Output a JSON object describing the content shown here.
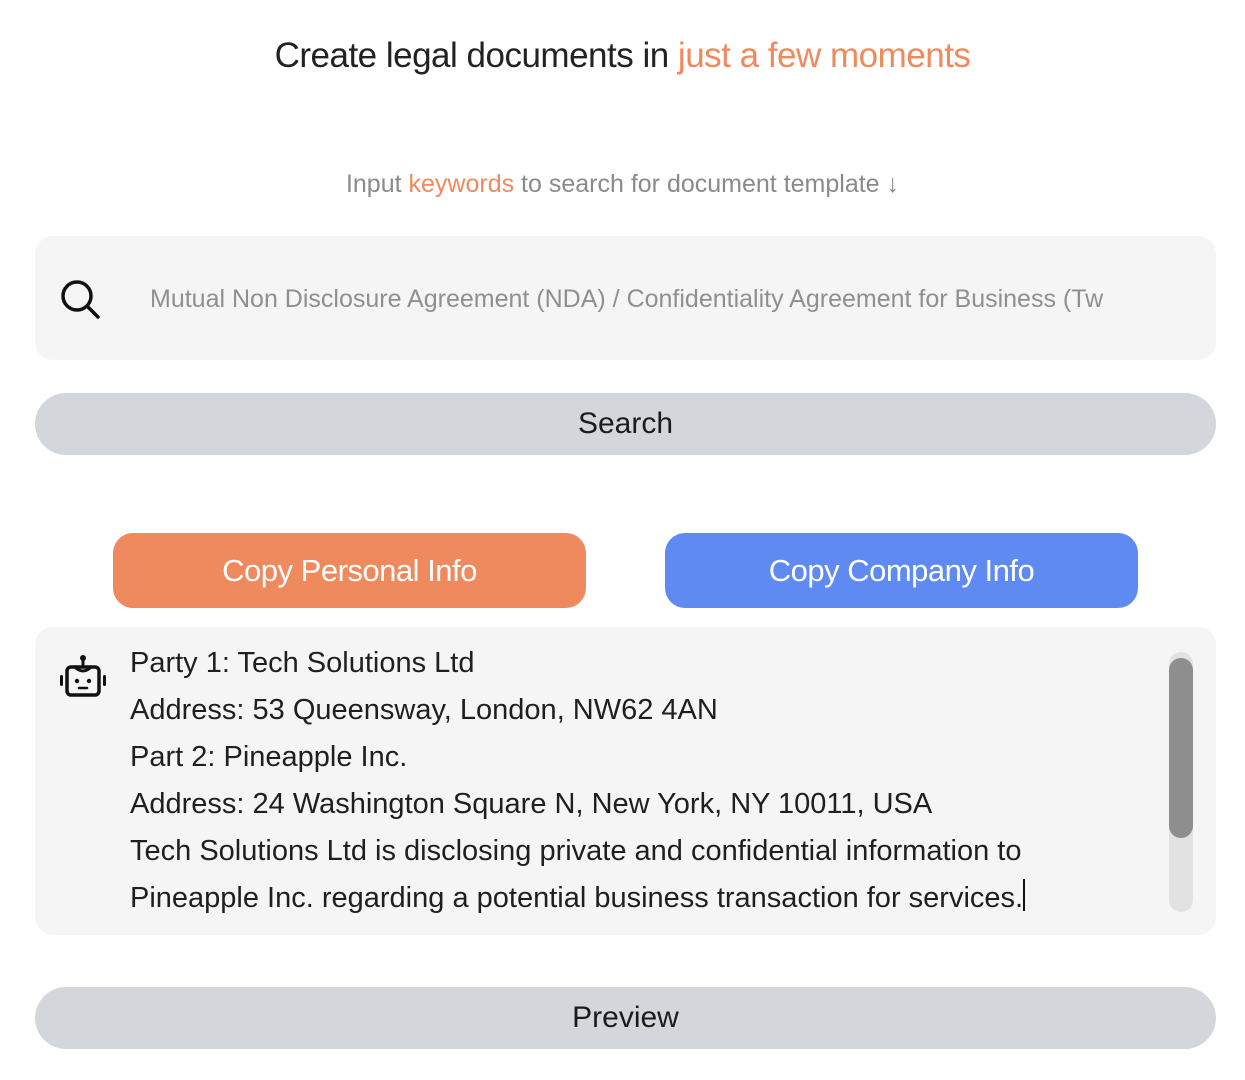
{
  "header": {
    "title_prefix": "Create legal documents in ",
    "title_accent": "just a few moments",
    "accent_color": "#ee8a5e"
  },
  "search": {
    "hint_prefix": "Input ",
    "hint_accent": "keywords",
    "hint_suffix": " to search for document template ↓",
    "value": "Mutual Non Disclosure Agreement (NDA) / Confidentiality Agreement for Business (Tw",
    "icon": "search-icon",
    "button_label": "Search"
  },
  "copy_buttons": {
    "personal_label": "Copy Personal Info",
    "personal_color": "#ef8a5f",
    "company_label": "Copy Company Info",
    "company_color": "#5f8af2"
  },
  "result": {
    "icon": "robot-icon",
    "lines": [
      "Party 1: Tech Solutions Ltd",
      "Address: 53 Queensway, London, NW62 4AN",
      "Part 2: Pineapple Inc.",
      "Address: 24 Washington Square N, New York, NY 10011, USA",
      "Tech Solutions Ltd is disclosing private and confidential information to",
      "Pineapple Inc. regarding a potential business transaction for services."
    ]
  },
  "preview": {
    "button_label": "Preview"
  }
}
